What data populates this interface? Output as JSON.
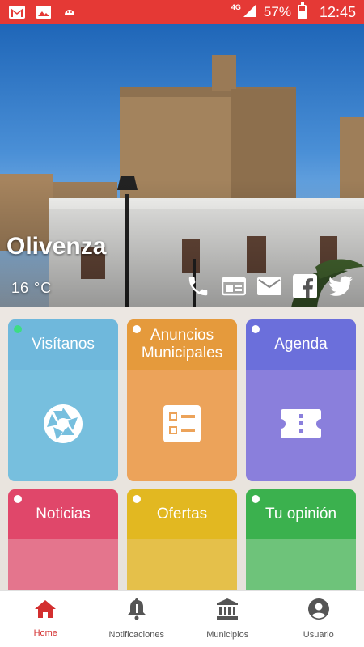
{
  "status_bar": {
    "network": "4G",
    "battery": "57%",
    "time": "12:45",
    "icons": [
      "gmail-icon",
      "image-icon",
      "android-icon",
      "signal-icon",
      "battery-icon"
    ]
  },
  "hero": {
    "city": "Olivenza",
    "temperature": "16 °C",
    "actions": [
      "phone-icon",
      "web-icon",
      "mail-icon",
      "facebook-icon",
      "twitter-icon"
    ]
  },
  "tiles": [
    {
      "label": "Visítanos",
      "icon": "aperture-icon",
      "head_color": "#6fb8dc",
      "body_color": "#77bfde",
      "dot": "green"
    },
    {
      "label": "Anuncios Municipales",
      "icon": "checklist-icon",
      "head_color": "#e59a3c",
      "body_color": "#eca35a",
      "dot": "white"
    },
    {
      "label": "Agenda",
      "icon": "ticket-icon",
      "head_color": "#6b6fdb",
      "body_color": "#8a7fdc",
      "dot": "white"
    },
    {
      "label": "Noticias",
      "icon": "rss-icon",
      "head_color": "#e0476a",
      "body_color": "#e4758d",
      "dot": "white"
    },
    {
      "label": "Ofertas",
      "icon": "shopping-bag-icon",
      "head_color": "#e2b821",
      "body_color": "#e5c04a",
      "dot": "white"
    },
    {
      "label": "Tu opinión",
      "icon": "smiley-icon",
      "head_color": "#3bb14e",
      "body_color": "#6ec37a",
      "dot": "white"
    }
  ],
  "bottom_nav": [
    {
      "label": "Home",
      "icon": "home-icon",
      "active": true
    },
    {
      "label": "Notificaciones",
      "icon": "bell-icon",
      "active": false
    },
    {
      "label": "Municipios",
      "icon": "bank-icon",
      "active": false
    },
    {
      "label": "Usuario",
      "icon": "user-icon",
      "active": false
    }
  ],
  "colors": {
    "status_bar": "#e53935",
    "active_nav": "#d32f2f",
    "inactive_nav": "#555555"
  }
}
